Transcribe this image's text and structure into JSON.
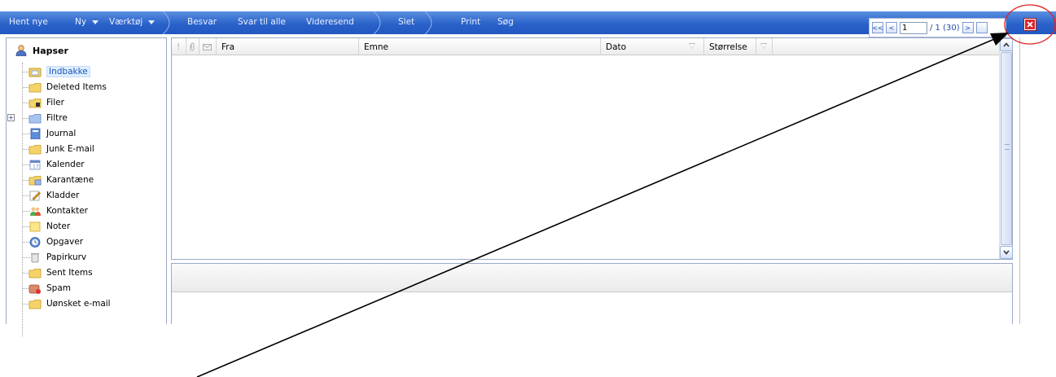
{
  "toolbar": {
    "hent_nye": "Hent nye",
    "ny": "Ny",
    "vaerktoj": "Værktøj",
    "besvar": "Besvar",
    "svar_til_alle": "Svar til alle",
    "videresend": "Videresend",
    "slet": "Slet",
    "print": "Print",
    "sog": "Søg",
    "colors": {
      "top": "#5b8fe0",
      "bottom": "#2157c1"
    }
  },
  "pager": {
    "first": "<<",
    "prev": "<",
    "page_value": "1",
    "page_info": "/ 1  (30)",
    "next": ">"
  },
  "tree": {
    "root": "Hapser",
    "items": [
      {
        "label": "Indbakke",
        "icon": "inbox-folder-icon",
        "selected": true
      },
      {
        "label": "Deleted Items",
        "icon": "folder-icon"
      },
      {
        "label": "Filer",
        "icon": "files-folder-icon"
      },
      {
        "label": "Filtre",
        "icon": "filter-folder-icon",
        "expandable": true
      },
      {
        "label": "Journal",
        "icon": "journal-icon"
      },
      {
        "label": "Junk E-mail",
        "icon": "folder-icon"
      },
      {
        "label": "Kalender",
        "icon": "calendar-icon"
      },
      {
        "label": "Karantæne",
        "icon": "quarantine-icon"
      },
      {
        "label": "Kladder",
        "icon": "drafts-icon"
      },
      {
        "label": "Kontakter",
        "icon": "contacts-icon"
      },
      {
        "label": "Noter",
        "icon": "notes-icon"
      },
      {
        "label": "Opgaver",
        "icon": "tasks-icon"
      },
      {
        "label": "Papirkurv",
        "icon": "trash-icon"
      },
      {
        "label": "Sent Items",
        "icon": "folder-icon"
      },
      {
        "label": "Spam",
        "icon": "spam-icon"
      },
      {
        "label": "Uønsket e-mail",
        "icon": "folder-icon"
      }
    ]
  },
  "list": {
    "columns": {
      "importance": "!",
      "attachment": "",
      "read": "",
      "fra": "Fra",
      "emne": "Emne",
      "dato": "Dato",
      "storrelse": "Størrelse"
    }
  },
  "annotation": {
    "color_circle": "#e02020",
    "color_arrow": "#000000"
  }
}
